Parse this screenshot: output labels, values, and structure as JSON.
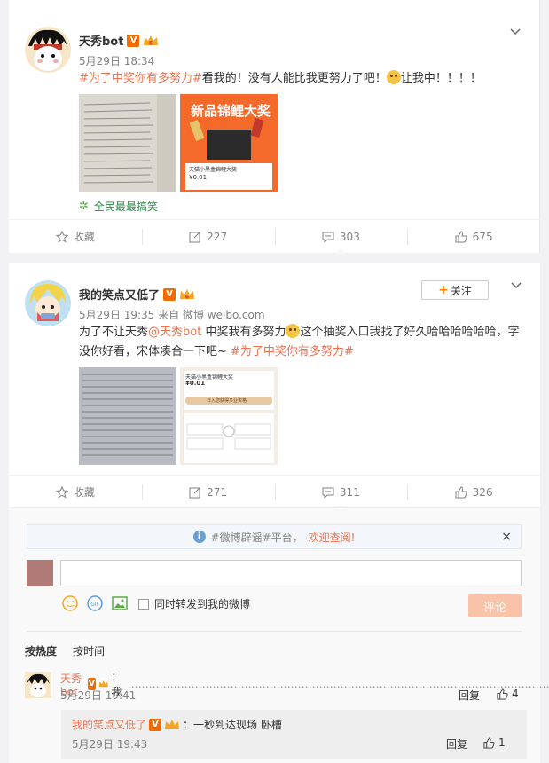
{
  "post1": {
    "author": "天秀bot",
    "time": "5月29日 18:34",
    "topic": "#为了中奖你有多努力#",
    "text_a": "看我的！没有人能比我更努力了吧！",
    "text_b": "让我中！！！！",
    "image2_title": "新品锦鲤大奖",
    "image2_sub": "天猫小黑盒锦鲤大奖",
    "image2_price": "¥0.01",
    "funny_label": "全民最最搞笑",
    "actions": {
      "fav": "收藏",
      "repost": "227",
      "comment": "303",
      "like": "675"
    }
  },
  "post2": {
    "author": "我的笑点又低了",
    "follow_label": "关注",
    "time": "5月29日 19:35",
    "source_prefix": "来自",
    "source": "微博 weibo.com",
    "text_a": "为了不让天秀",
    "mention": "@天秀bot",
    "text_b": " 中奖我有多努力",
    "text_c": "这个抽奖入口我找了好久哈哈哈哈哈哈，字没你好看，宋体凑合一下吧~ ",
    "topic": "#为了中奖你有多努力#",
    "image2_sub": "天猫小黑盒锦鲤大奖",
    "image2_price": "¥0.01",
    "image2_button": "日入您获得多业资格",
    "actions": {
      "fav": "收藏",
      "repost": "271",
      "comment": "311",
      "like": "326"
    }
  },
  "comments": {
    "rumor_text": "#微博辟谣#平台，",
    "rumor_link": "欢迎查阅!",
    "sync_label": "同时转发到我的微博",
    "post_button": "评论",
    "sort_hot": "按热度",
    "sort_time": "按时间",
    "list": [
      {
        "author": "天秀bot",
        "text": "：我",
        "dots": "…………………………………………………………………………………………………………",
        "time": "5月29日 19:41",
        "reply": "回复",
        "likes": "4"
      }
    ],
    "sub": {
      "author": "我的笑点又低了",
      "text": "：一秒到达现场 卧槽",
      "time": "5月29日 19:43",
      "reply": "回复",
      "likes": "1"
    }
  },
  "colors": {
    "accent": "#eb7350",
    "brand_orange": "#ff8200",
    "vip": "#f06b00"
  }
}
